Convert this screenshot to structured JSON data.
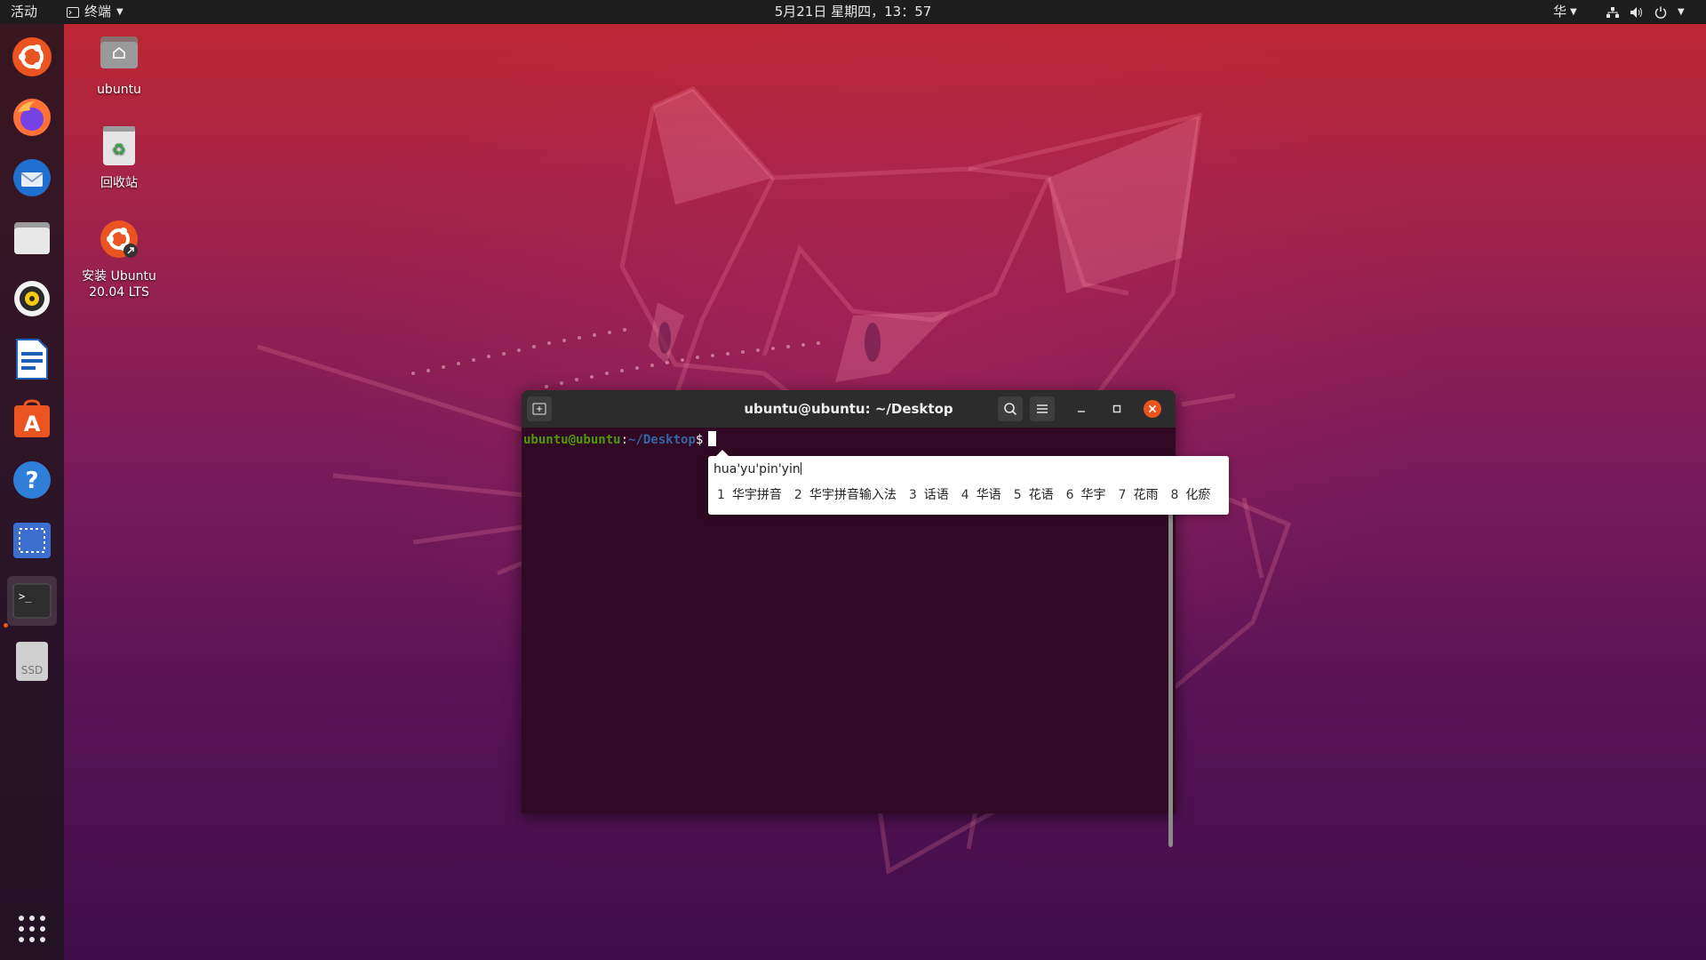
{
  "topbar": {
    "activities": "活动",
    "app_menu": "终端",
    "clock": "5月21日 星期四，13：57",
    "ime": "华"
  },
  "dock": {
    "items": [
      {
        "name": "ubuntu-installer-icon"
      },
      {
        "name": "firefox-icon"
      },
      {
        "name": "thunderbird-icon"
      },
      {
        "name": "files-icon"
      },
      {
        "name": "rhythmbox-icon"
      },
      {
        "name": "libreoffice-writer-icon"
      },
      {
        "name": "software-center-icon"
      },
      {
        "name": "help-icon"
      },
      {
        "name": "screenshot-icon"
      },
      {
        "name": "terminal-icon"
      },
      {
        "name": "ssd-drive-icon",
        "label": "SSD"
      }
    ],
    "apps_grid": "show-applications-icon"
  },
  "desktop": {
    "icons": [
      {
        "label": "ubuntu"
      },
      {
        "label": "回收站"
      },
      {
        "label": "安装 Ubuntu 20.04 LTS"
      }
    ]
  },
  "terminal": {
    "title": "ubuntu@ubuntu: ~/Desktop",
    "prompt": {
      "user_host": "ubuntu@ubuntu",
      "colon": ":",
      "path": "~/Desktop",
      "dollar": "$"
    }
  },
  "ime_popup": {
    "preedit": "hua'yu'pin'yin",
    "candidates": [
      {
        "num": "1",
        "text": "华宇拼音"
      },
      {
        "num": "2",
        "text": "华宇拼音输入法"
      },
      {
        "num": "3",
        "text": "话语"
      },
      {
        "num": "4",
        "text": "华语"
      },
      {
        "num": "5",
        "text": "花语"
      },
      {
        "num": "6",
        "text": "华宇"
      },
      {
        "num": "7",
        "text": "花雨"
      },
      {
        "num": "8",
        "text": "化瘀"
      }
    ]
  },
  "colors": {
    "accent": "#e95420",
    "terminal_bg": "#300a24",
    "prompt_user": "#4e9a06",
    "prompt_path": "#3465a4"
  }
}
